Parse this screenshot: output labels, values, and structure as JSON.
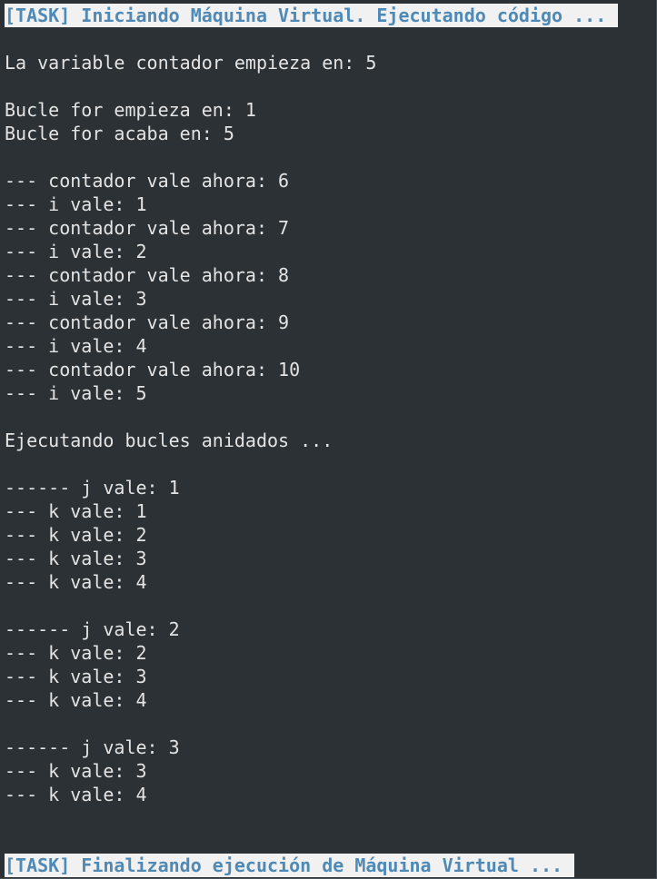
{
  "terminal": {
    "header_banner": "[TASK] Iniciando Máquina Virtual. Ejecutando código ...",
    "footer_banner": "[TASK] Finalizando ejecución de Máquina Virtual ...",
    "lines": [
      "",
      "La variable contador empieza en: 5",
      "",
      "Bucle for empieza en: 1",
      "Bucle for acaba en: 5",
      "",
      "--- contador vale ahora: 6",
      "--- i vale: 1",
      "--- contador vale ahora: 7",
      "--- i vale: 2",
      "--- contador vale ahora: 8",
      "--- i vale: 3",
      "--- contador vale ahora: 9",
      "--- i vale: 4",
      "--- contador vale ahora: 10",
      "--- i vale: 5",
      "",
      "Ejecutando bucles anidados ...",
      "",
      "------ j vale: 1",
      "--- k vale: 1",
      "--- k vale: 2",
      "--- k vale: 3",
      "--- k vale: 4",
      "",
      "------ j vale: 2",
      "--- k vale: 2",
      "--- k vale: 3",
      "--- k vale: 4",
      "",
      "------ j vale: 3",
      "--- k vale: 3",
      "--- k vale: 4"
    ]
  }
}
